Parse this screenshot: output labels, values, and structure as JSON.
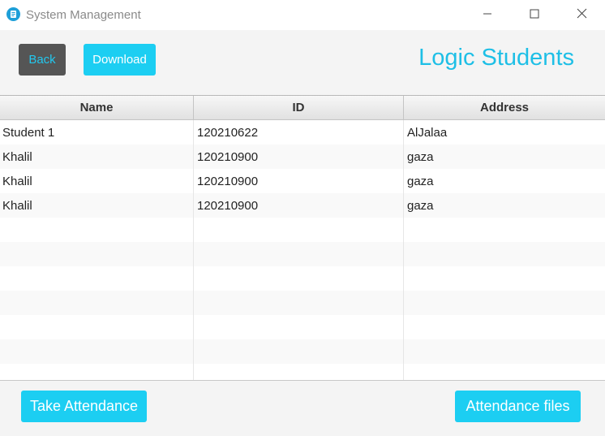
{
  "window": {
    "title": "System Management",
    "controls": {
      "minimize": "minimize-icon",
      "maximize": "maximize-icon",
      "close": "close-icon"
    }
  },
  "toolbar": {
    "back_label": "Back",
    "download_label": "Download",
    "page_title": "Logic Students"
  },
  "table": {
    "columns": [
      "Name",
      "ID",
      "Address"
    ],
    "rows": [
      [
        "Student 1",
        "120210622",
        "AlJalaa"
      ],
      [
        "Khalil",
        "120210900",
        "gaza"
      ],
      [
        "Khalil",
        "120210900",
        "gaza"
      ],
      [
        "Khalil",
        "120210900",
        "gaza"
      ]
    ]
  },
  "footer": {
    "take_attendance_label": "Take Attendance",
    "attendance_files_label": "Attendance files"
  },
  "colors": {
    "accent": "#1ccef2",
    "title_accent": "#1ebfe6",
    "back_button_bg": "#555555",
    "window_bg": "#f4f4f4"
  }
}
